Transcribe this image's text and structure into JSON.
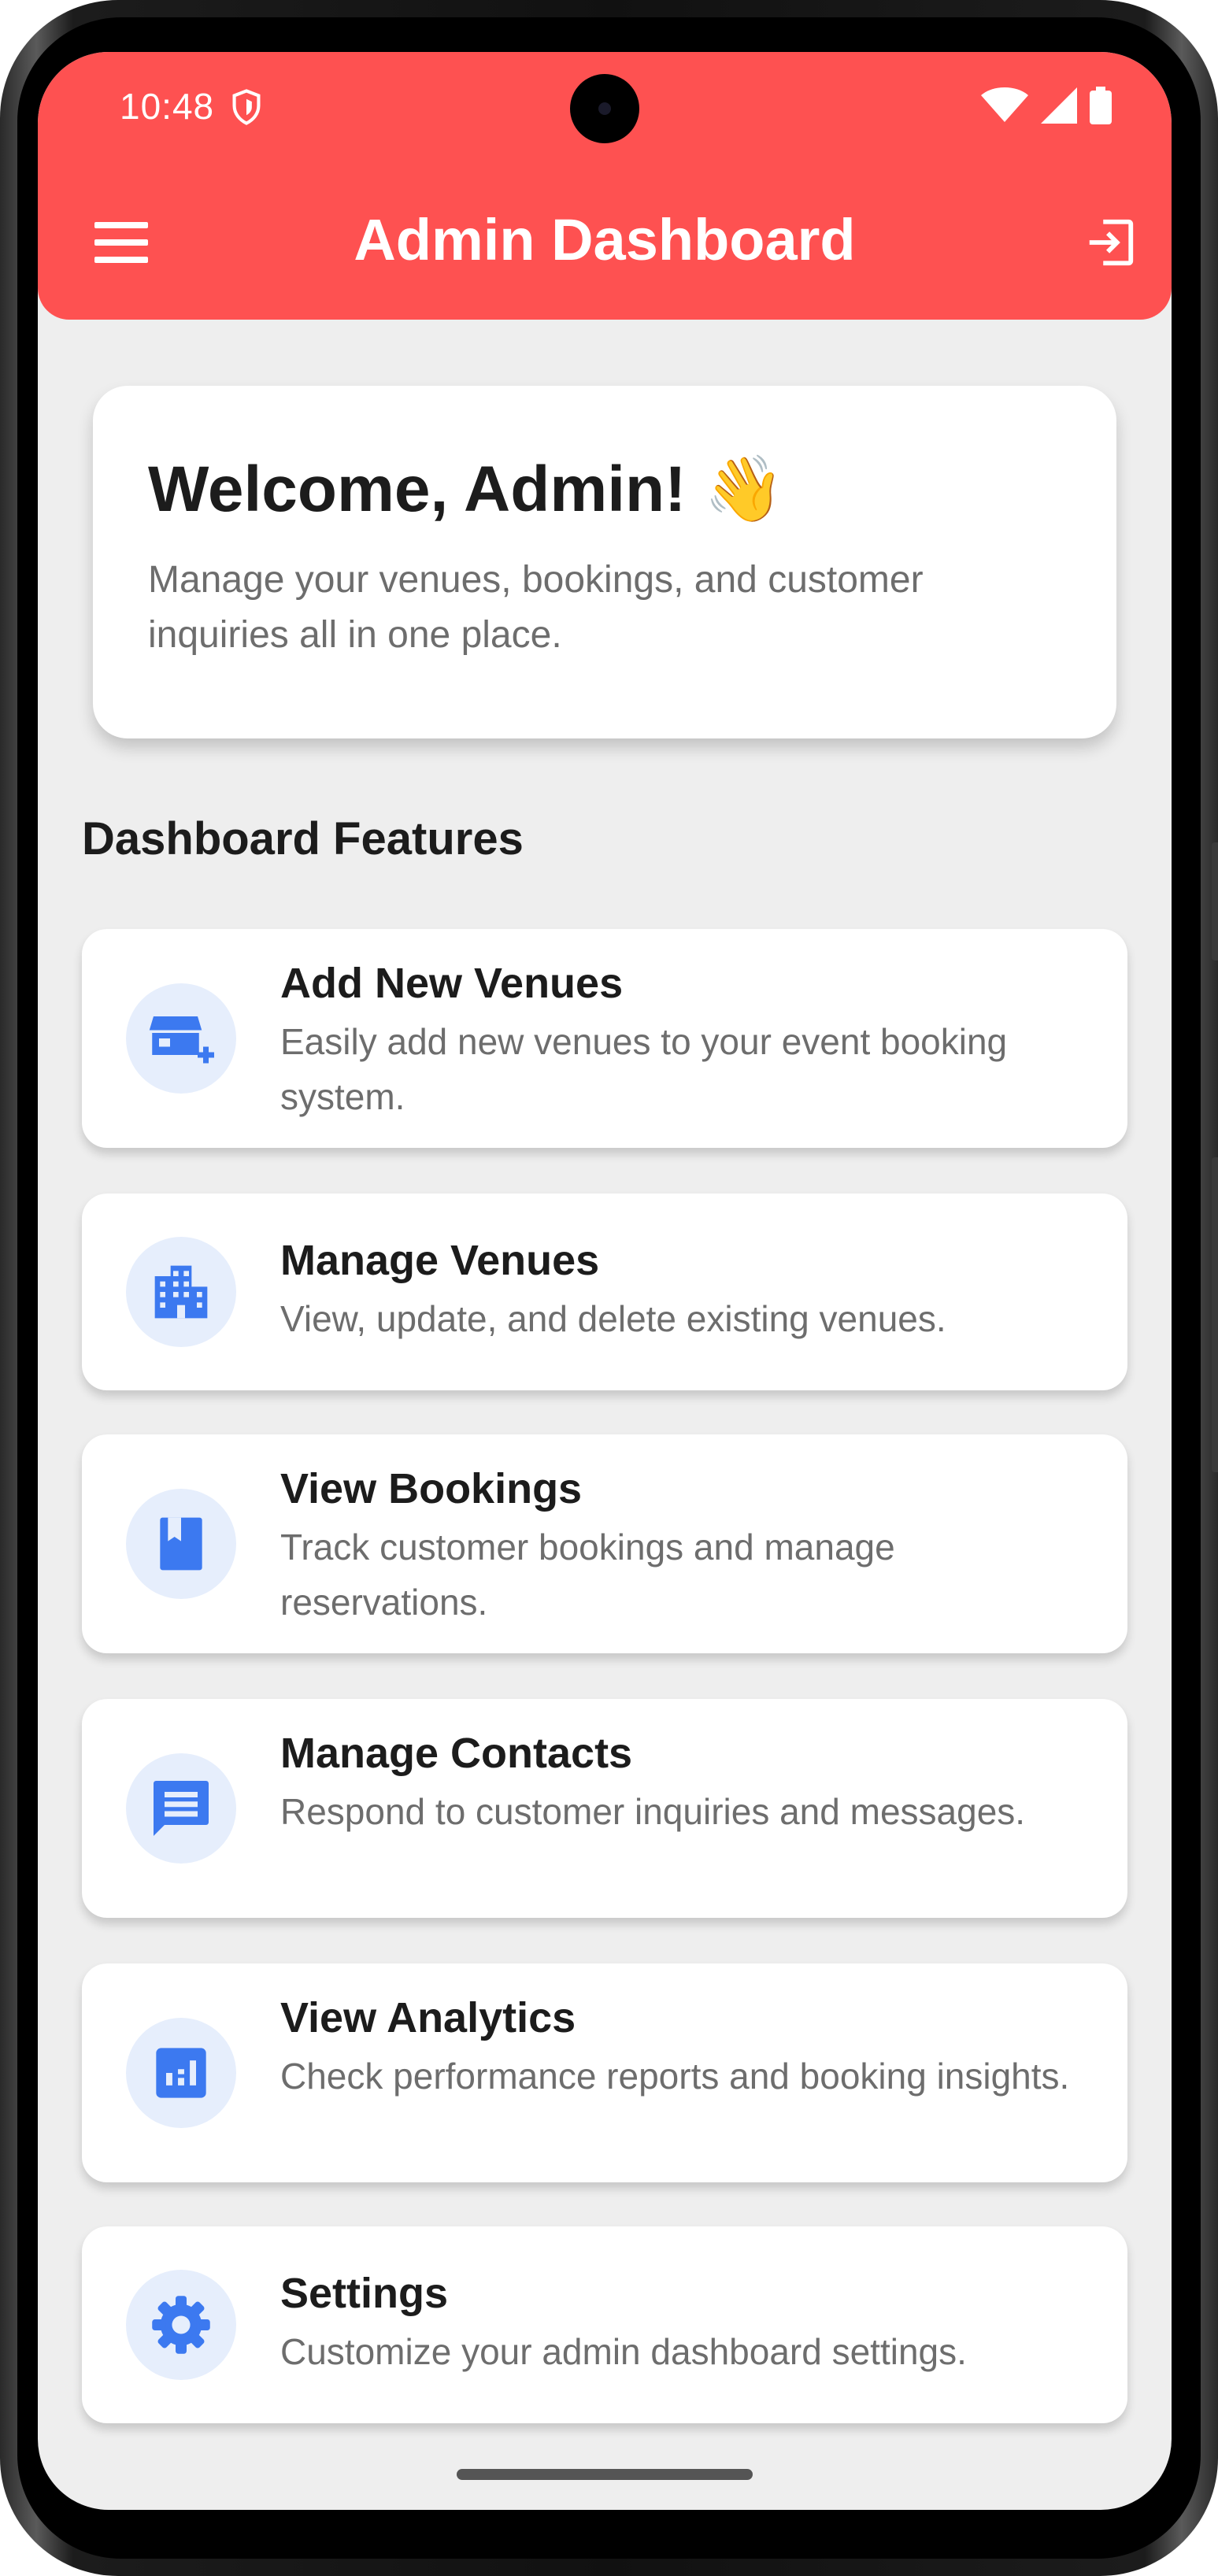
{
  "status_bar": {
    "time": "10:48"
  },
  "app_bar": {
    "title": "Admin Dashboard",
    "background": "#fe5151"
  },
  "welcome": {
    "heading": "Welcome, Admin! 👋",
    "text": "Manage your venues, bookings, and customer inquiries all in one place."
  },
  "section_title": "Dashboard Features",
  "features": [
    {
      "icon": "add-business-icon",
      "title": "Add New Venues",
      "description": "Easily add new venues to your event booking system."
    },
    {
      "icon": "apartment-icon",
      "title": "Manage Venues",
      "description": "View, update, and delete existing venues."
    },
    {
      "icon": "book-icon",
      "title": "View Bookings",
      "description": "Track customer bookings and manage reservations."
    },
    {
      "icon": "message-icon",
      "title": "Manage Contacts",
      "description": "Respond to customer inquiries and messages."
    },
    {
      "icon": "analytics-icon",
      "title": "View Analytics",
      "description": "Check performance reports and booking insights."
    },
    {
      "icon": "settings-icon",
      "title": "Settings",
      "description": "Customize your admin dashboard settings."
    }
  ],
  "colors": {
    "accent": "#3c79f0",
    "icon_bg": "#e6eefc",
    "app_bar": "#fe5151",
    "page_bg": "#eeeeee"
  }
}
